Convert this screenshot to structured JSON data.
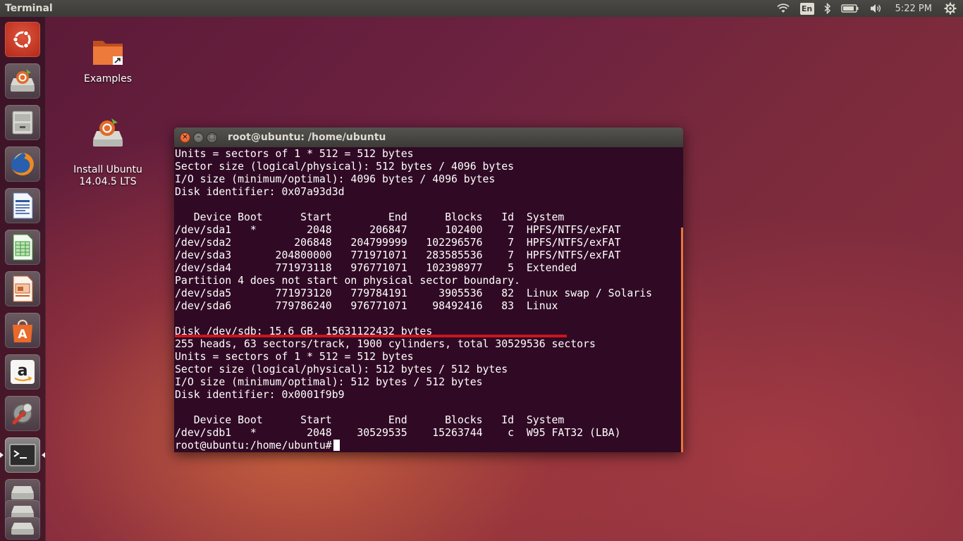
{
  "top_panel": {
    "app_title": "Terminal",
    "lang_indicator": "En",
    "clock": "5:22 PM"
  },
  "launcher": {
    "items": [
      {
        "name": "Dash"
      },
      {
        "name": "Install Ubuntu 14.04.5 LTS"
      },
      {
        "name": "Files"
      },
      {
        "name": "Firefox Web Browser"
      },
      {
        "name": "LibreOffice Writer"
      },
      {
        "name": "LibreOffice Calc"
      },
      {
        "name": "LibreOffice Impress"
      },
      {
        "name": "Ubuntu Software Center"
      },
      {
        "name": "Amazon"
      },
      {
        "name": "System Settings"
      },
      {
        "name": "Terminal"
      },
      {
        "name": "Drive 1"
      },
      {
        "name": "Drive 2"
      },
      {
        "name": "Drive 3"
      }
    ]
  },
  "desktop": {
    "icons": [
      {
        "label": "Examples"
      },
      {
        "label": "Install Ubuntu\n14.04.5 LTS"
      }
    ]
  },
  "terminal": {
    "title": "root@ubuntu: /home/ubuntu",
    "lines": [
      "Units = sectors of 1 * 512 = 512 bytes",
      "Sector size (logical/physical): 512 bytes / 4096 bytes",
      "I/O size (minimum/optimal): 4096 bytes / 4096 bytes",
      "Disk identifier: 0x07a93d3d",
      "",
      "   Device Boot      Start         End      Blocks   Id  System",
      "/dev/sda1   *        2048      206847      102400    7  HPFS/NTFS/exFAT",
      "/dev/sda2          206848   204799999   102296576    7  HPFS/NTFS/exFAT",
      "/dev/sda3       204800000   771971071   283585536    7  HPFS/NTFS/exFAT",
      "/dev/sda4       771973118   976771071   102398977    5  Extended",
      "Partition 4 does not start on physical sector boundary.",
      "/dev/sda5       771973120   779784191     3905536   82  Linux swap / Solaris",
      "/dev/sda6       779786240   976771071    98492416   83  Linux",
      "",
      "Disk /dev/sdb: 15.6 GB, 15631122432 bytes",
      "255 heads, 63 sectors/track, 1900 cylinders, total 30529536 sectors",
      "Units = sectors of 1 * 512 = 512 bytes",
      "Sector size (logical/physical): 512 bytes / 512 bytes",
      "I/O size (minimum/optimal): 512 bytes / 512 bytes",
      "Disk identifier: 0x0001f9b9",
      "",
      "   Device Boot      Start         End      Blocks   Id  System",
      "/dev/sdb1   *        2048    30529535    15263744    c  W95 FAT32 (LBA)"
    ],
    "prompt": "root@ubuntu:/home/ubuntu# "
  },
  "colors": {
    "terminal_bg": "#300a24",
    "panel_bg": "#3c3b37",
    "highlight_red": "#c9151e",
    "scrollbar_orange": "#e8763c"
  }
}
